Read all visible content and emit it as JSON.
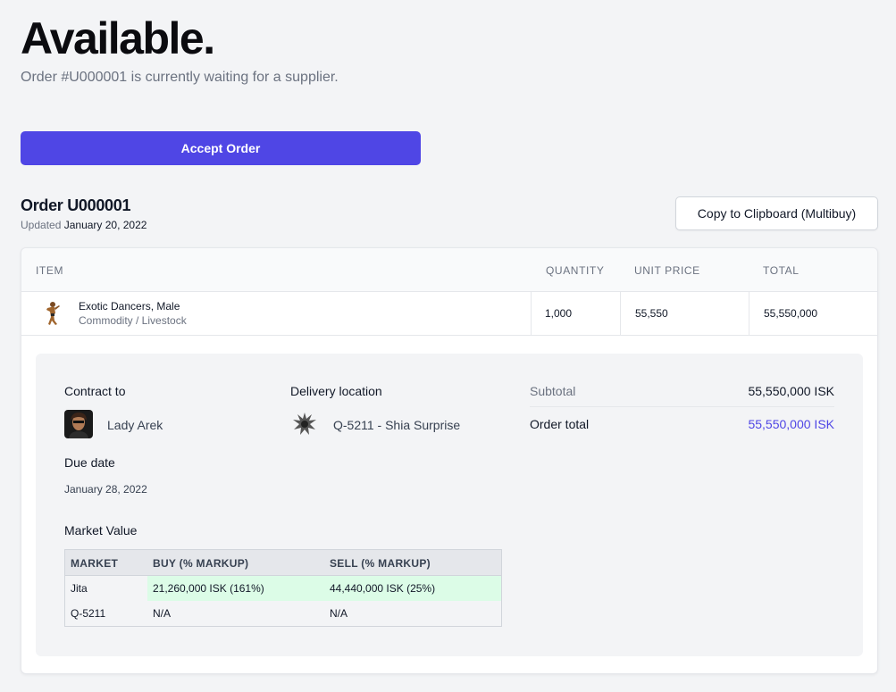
{
  "header": {
    "title": "Available.",
    "subtitle": "Order #U000001 is currently waiting for a supplier."
  },
  "actions": {
    "accept_label": "Accept Order",
    "copy_label": "Copy to Clipboard (Multibuy)"
  },
  "order": {
    "title": "Order U000001",
    "updated_prefix": "Updated",
    "updated_date": "January 20, 2022"
  },
  "table": {
    "columns": [
      "ITEM",
      "QUANTITY",
      "UNIT PRICE",
      "TOTAL"
    ],
    "rows": [
      {
        "name": "Exotic Dancers, Male",
        "category": "Commodity / Livestock",
        "quantity": "1,000",
        "unit_price": "55,550",
        "total": "55,550,000",
        "icon": "dancer-icon"
      }
    ]
  },
  "details": {
    "contract_label": "Contract to",
    "contract_name": "Lady Arek",
    "delivery_label": "Delivery location",
    "delivery_name": "Q-5211 - Shia Surprise",
    "due_label": "Due date",
    "due_date": "January 28, 2022",
    "subtotal_label": "Subtotal",
    "subtotal_value": "55,550,000 ISK",
    "order_total_label": "Order total",
    "order_total_value": "55,550,000 ISK"
  },
  "market": {
    "title": "Market Value",
    "columns": [
      "MARKET",
      "BUY (% MARKUP)",
      "SELL (% MARKUP)"
    ],
    "rows": [
      {
        "market": "Jita",
        "buy": "21,260,000 ISK (161%)",
        "sell": "44,440,000 ISK (25%)"
      },
      {
        "market": "Q-5211",
        "buy": "N/A",
        "sell": "N/A"
      }
    ]
  },
  "colors": {
    "accent": "#4f46e5",
    "highlight": "#dcfce7",
    "background": "#f3f4f6"
  }
}
